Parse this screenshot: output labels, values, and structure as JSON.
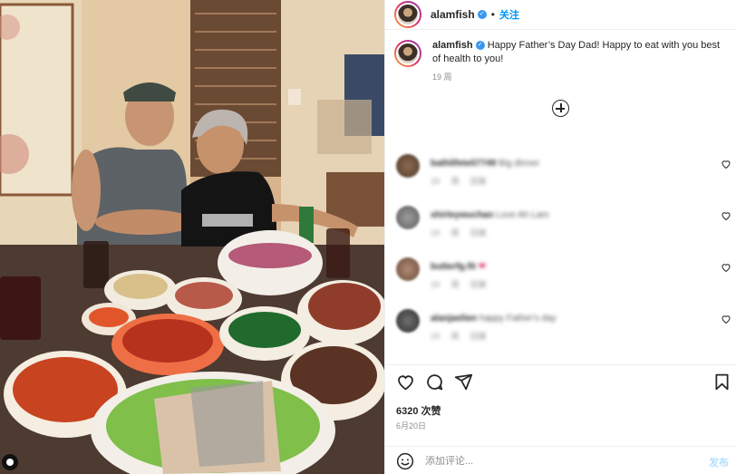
{
  "post": {
    "username": "alamfish",
    "follow_label": "关注",
    "separator": "•",
    "verified_glyph": "✓",
    "caption_text": "Happy Father’s Day Dad! Happy to eat with you best of health to you!",
    "caption_time": "19 周",
    "likes": "6320 次赞",
    "date": "6月20日"
  },
  "comments": [
    {
      "user": "bathlifeteli7749",
      "text": "Big dinner",
      "meta": "19 周 回复"
    },
    {
      "user": "shirleywuchan",
      "text": "Love Ah Lam",
      "meta": "19 周 回复"
    },
    {
      "user": "butterfg.fit",
      "text": "❤",
      "meta": "19 周 回复"
    },
    {
      "user": "alanjaelien",
      "text": "happy Father's day",
      "meta": "19 周 回复"
    }
  ],
  "comment_box": {
    "placeholder": "添加评论...",
    "post_label": "发布"
  },
  "icons": [
    "heart-icon",
    "comment-icon",
    "share-icon",
    "bookmark-icon",
    "emoji-icon",
    "add-circle-icon"
  ],
  "colors": {
    "accent": "#0095f6",
    "verified": "#3897f0",
    "muted": "#8e8e8e",
    "post_disabled": "#b2dffc"
  }
}
